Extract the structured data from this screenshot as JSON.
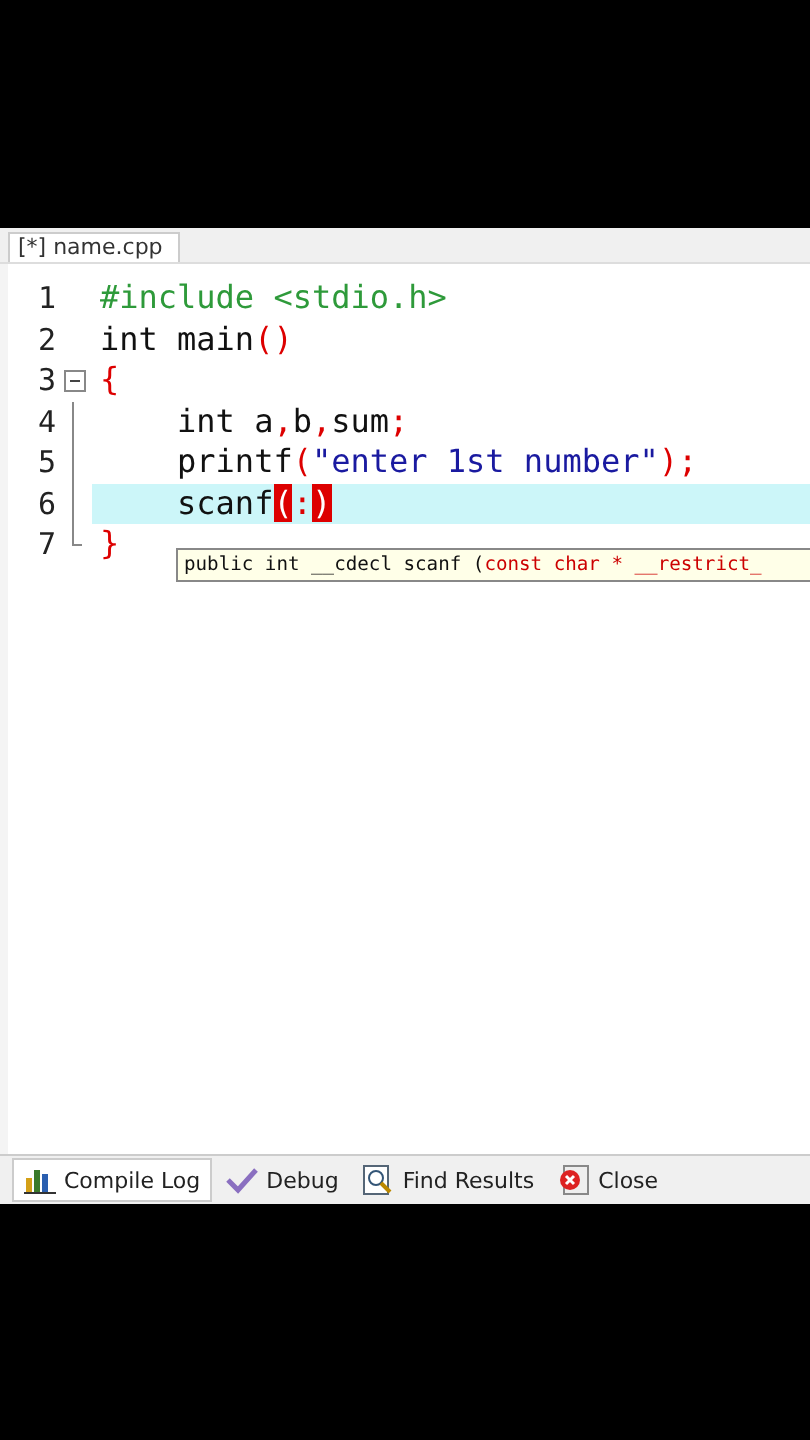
{
  "file_tab": {
    "label": "[*] name.cpp",
    "selected": true
  },
  "lines": [
    {
      "number": "1",
      "current": false,
      "kind": "plain",
      "tokens": [
        {
          "kind": "preproc",
          "text": "#include <stdio.h>"
        }
      ]
    },
    {
      "number": "2",
      "current": false,
      "kind": "plain",
      "tokens": [
        {
          "kind": "plain",
          "text": "int main"
        },
        {
          "kind": "punct",
          "text": "()"
        }
      ]
    },
    {
      "number": "3",
      "current": false,
      "kind": "fold-start",
      "tokens": [
        {
          "kind": "punct",
          "text": "{"
        }
      ]
    },
    {
      "number": "4",
      "current": false,
      "kind": "fold-body",
      "tokens": [
        {
          "kind": "plain",
          "text": "    int a"
        },
        {
          "kind": "punct",
          "text": ","
        },
        {
          "kind": "plain",
          "text": "b"
        },
        {
          "kind": "punct",
          "text": ","
        },
        {
          "kind": "plain",
          "text": "sum"
        },
        {
          "kind": "punct",
          "text": ";"
        }
      ]
    },
    {
      "number": "5",
      "current": false,
      "kind": "fold-body",
      "tokens": [
        {
          "kind": "plain",
          "text": "    printf"
        },
        {
          "kind": "punct",
          "text": "("
        },
        {
          "kind": "string",
          "text": "\"enter 1st number\""
        },
        {
          "kind": "punct",
          "text": ");"
        }
      ]
    },
    {
      "number": "6",
      "current": true,
      "kind": "fold-body",
      "tokens": [
        {
          "kind": "plain",
          "text": "    scanf"
        },
        {
          "kind": "match",
          "text": "("
        },
        {
          "kind": "punct",
          "text": ":"
        },
        {
          "kind": "match",
          "text": ")"
        }
      ]
    },
    {
      "number": "7",
      "current": false,
      "kind": "fold-end",
      "tokens": [
        {
          "kind": "punct",
          "text": "}"
        }
      ]
    }
  ],
  "tooltip": {
    "signature": "public int __cdecl scanf (",
    "parameter": "const char * __restrict_"
  },
  "bottom_tabs": [
    {
      "label": "Compile Log",
      "selected": true
    },
    {
      "label": "Debug",
      "selected": false
    },
    {
      "label": "Find Results",
      "selected": false
    },
    {
      "label": "Close",
      "selected": false
    }
  ]
}
